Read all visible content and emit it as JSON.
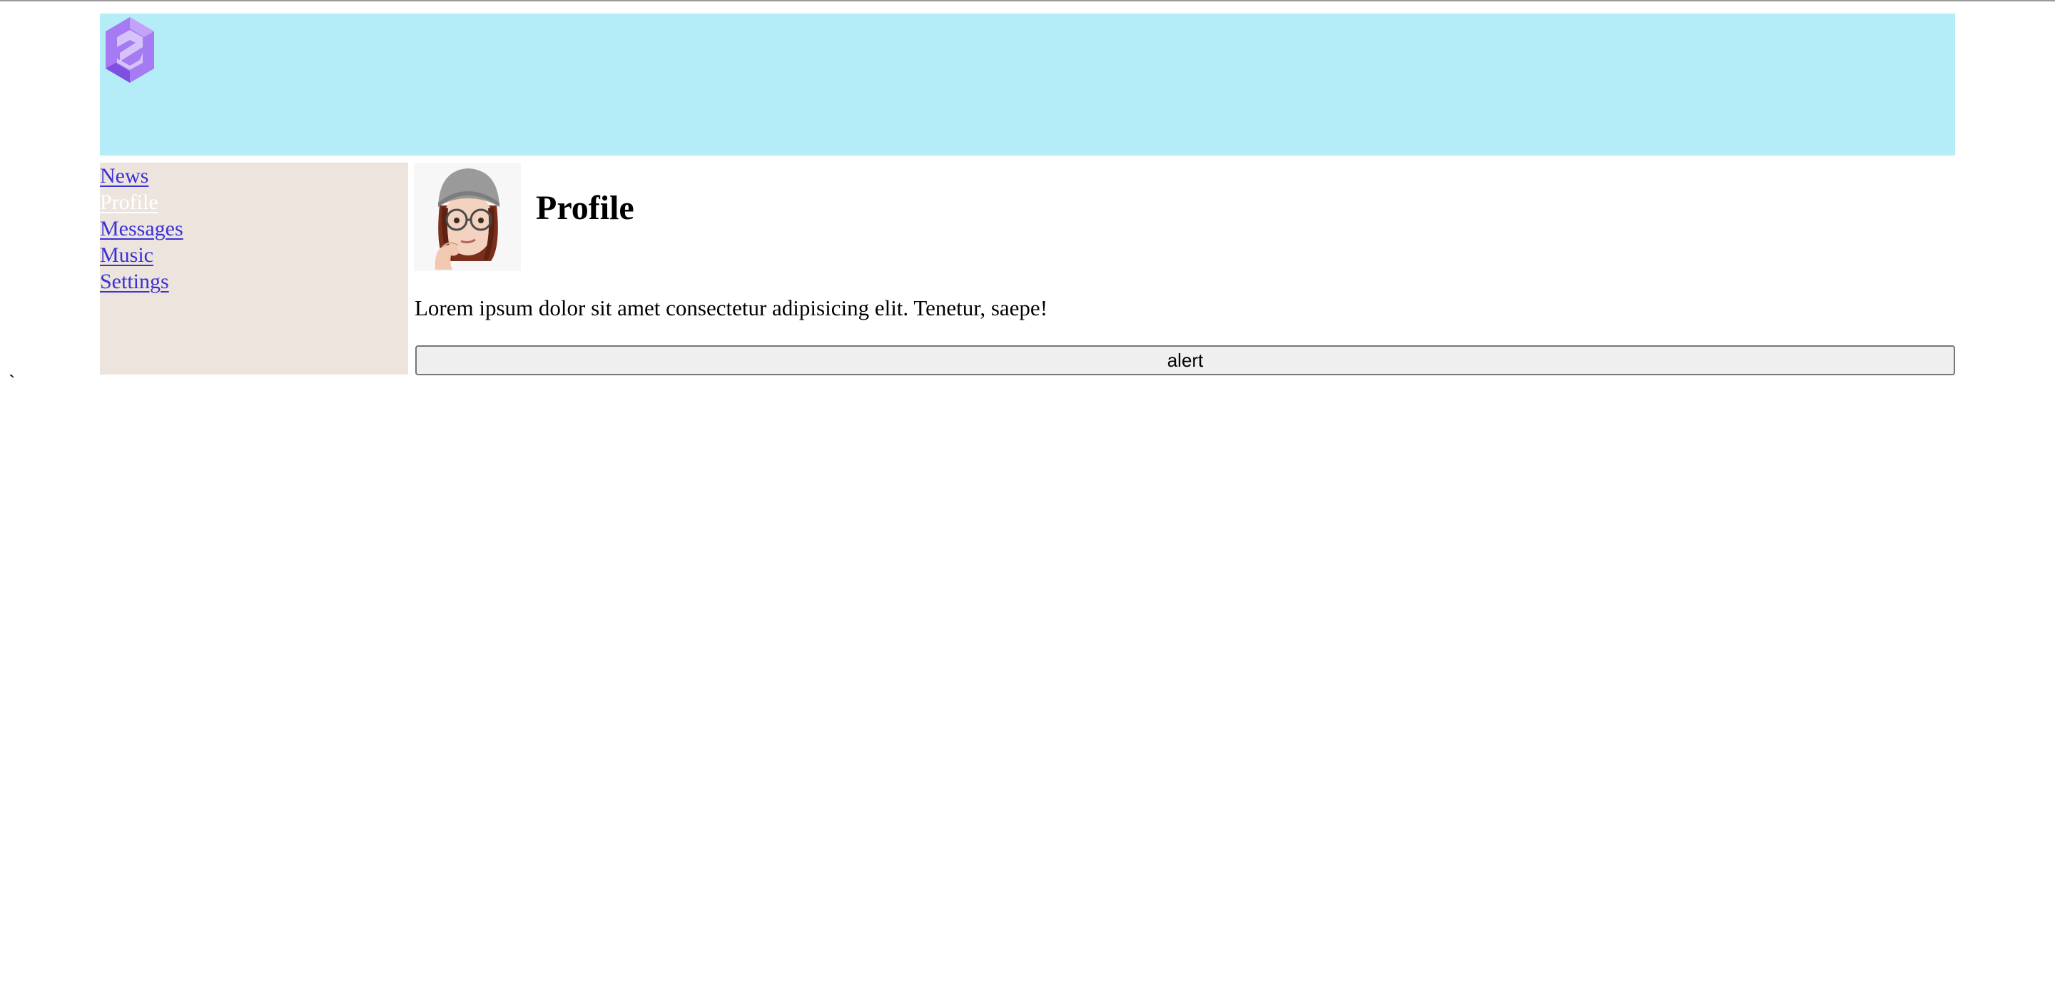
{
  "nav": {
    "items": [
      {
        "label": "News",
        "active": false
      },
      {
        "label": "Profile",
        "active": true
      },
      {
        "label": "Messages",
        "active": false
      },
      {
        "label": "Music",
        "active": false
      },
      {
        "label": "Settings",
        "active": false
      }
    ]
  },
  "profile": {
    "title": "Profile",
    "description": "Lorem ipsum dolor sit amet consectetur adipisicing elit. Tenetur, saepe!",
    "button_label": "alert"
  },
  "misc": {
    "stray_char": "`"
  },
  "colors": {
    "header_bg": "#b4ecf8",
    "sidebar_bg": "#ede4de",
    "link": "#3a32d6",
    "active_link": "#ffffff",
    "logo": "#9b6cf0"
  },
  "icons": {
    "logo": "hexagon-logo-icon",
    "avatar": "memoji-avatar"
  }
}
